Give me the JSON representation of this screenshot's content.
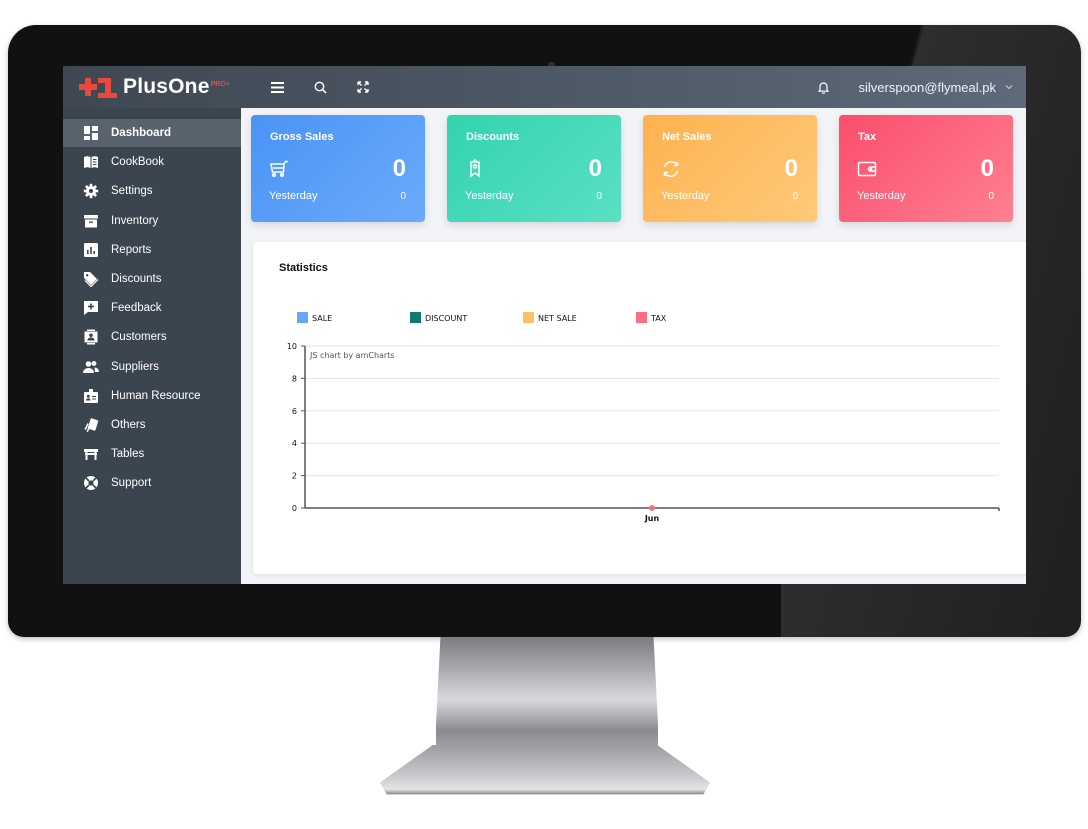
{
  "brand": {
    "name": "PlusOne",
    "badge": "PRO+",
    "accent": "#e84a3c"
  },
  "topbar": {
    "icons": [
      "menu-icon",
      "search-icon",
      "fullscreen-icon",
      "bell-icon"
    ],
    "user_email": "silverspoon@flymeal.pk"
  },
  "sidebar": {
    "items": [
      {
        "label": "Dashboard",
        "icon": "dashboard-icon",
        "active": true
      },
      {
        "label": "CookBook",
        "icon": "book-icon"
      },
      {
        "label": "Settings",
        "icon": "gear-icon"
      },
      {
        "label": "Inventory",
        "icon": "archive-box-icon"
      },
      {
        "label": "Reports",
        "icon": "bar-chart-icon"
      },
      {
        "label": "Discounts",
        "icon": "tag-icon"
      },
      {
        "label": "Feedback",
        "icon": "comment-plus-icon"
      },
      {
        "label": "Customers",
        "icon": "contact-card-icon"
      },
      {
        "label": "Suppliers",
        "icon": "users-icon"
      },
      {
        "label": "Human Resource",
        "icon": "id-badge-icon"
      },
      {
        "label": "Others",
        "icon": "cards-icon"
      },
      {
        "label": "Tables",
        "icon": "table-icon"
      },
      {
        "label": "Support",
        "icon": "life-ring-icon"
      }
    ]
  },
  "cards": [
    {
      "title": "Gross Sales",
      "icon": "cart-icon",
      "value": "0",
      "sub_label": "Yesterday",
      "sub_value": "0",
      "color": "#4a94f5"
    },
    {
      "title": "Discounts",
      "icon": "ribbon-tag-icon",
      "value": "0",
      "sub_label": "Yesterday",
      "sub_value": "0",
      "color": "#33d3ae"
    },
    {
      "title": "Net Sales",
      "icon": "refresh-icon",
      "value": "0",
      "sub_label": "Yesterday",
      "sub_value": "0",
      "color": "#fdb24e"
    },
    {
      "title": "Tax",
      "icon": "wallet-icon",
      "value": "0",
      "sub_label": "Yesterday",
      "sub_value": "0",
      "color": "#fa4d6c"
    }
  ],
  "statistics": {
    "title": "Statistics",
    "watermark": "JS chart by amCharts"
  },
  "chart_data": {
    "type": "line",
    "title": "Statistics",
    "categories": [
      "Jun"
    ],
    "series": [
      {
        "name": "SALE",
        "color": "#67a6f8",
        "values": [
          0
        ]
      },
      {
        "name": "DISCOUNT",
        "color": "#0f7b73",
        "values": [
          0
        ]
      },
      {
        "name": "NET SALE",
        "color": "#fcc06a",
        "values": [
          0
        ]
      },
      {
        "name": "TAX",
        "color": "#fb6d82",
        "values": [
          0
        ]
      }
    ],
    "yticks": [
      0,
      2,
      4,
      6,
      8,
      10
    ],
    "ylim": [
      0,
      10
    ],
    "xlabel": "",
    "ylabel": "",
    "grid": true,
    "legend": "top"
  }
}
